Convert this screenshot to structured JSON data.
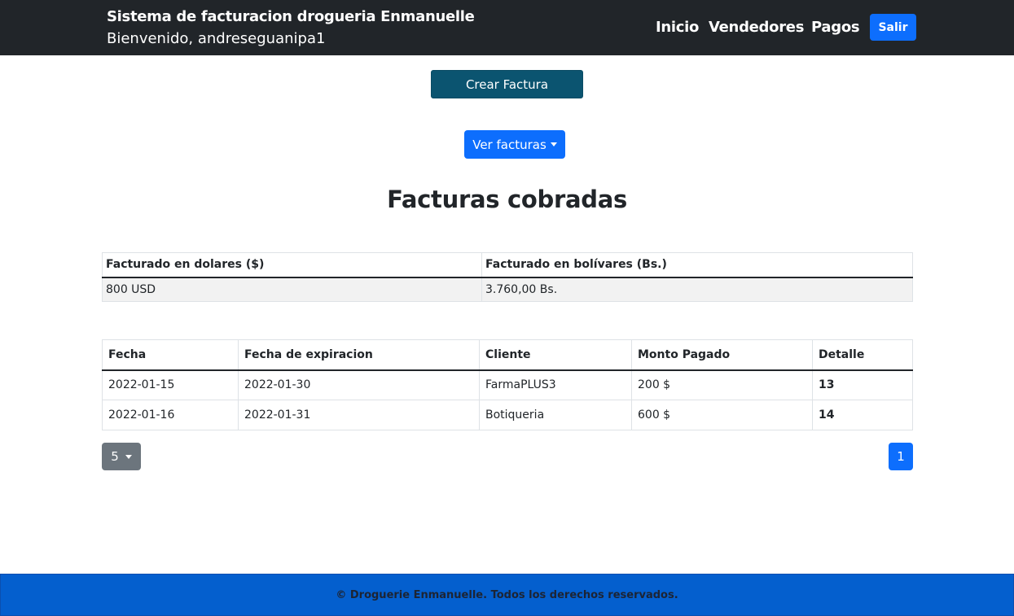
{
  "navbar": {
    "brand_title": "Sistema de facturacion drogueria Enmanuelle",
    "welcome": "Bienvenido, andreseguanipa1",
    "links": [
      "Inicio",
      "Vendedores",
      "Pagos"
    ],
    "logout_label": "Salir"
  },
  "actions": {
    "create_invoice_label": "Crear Factura",
    "view_invoices_label": "Ver facturas"
  },
  "page_title": "Facturas cobradas",
  "summary": {
    "headers": [
      "Facturado en dolares ($)",
      "Facturado en bolívares (Bs.)"
    ],
    "values": [
      "800 USD",
      "3.760,00 Bs."
    ]
  },
  "invoices": {
    "headers": [
      "Fecha",
      "Fecha de expiracion",
      "Cliente",
      "Monto Pagado",
      "Detalle"
    ],
    "rows": [
      [
        "2022-01-15",
        "2022-01-30",
        "FarmaPLUS3",
        "200 $",
        "13"
      ],
      [
        "2022-01-16",
        "2022-01-31",
        "Botiqueria",
        "600 $",
        "14"
      ]
    ]
  },
  "pagination": {
    "per_page": "5",
    "current_page": "1"
  },
  "footer": {
    "text": "© Droguerie Enmanuelle. Todos los derechos reservados."
  },
  "colors": {
    "navbar_bg": "#212529",
    "primary": "#0d6efd",
    "create_button": "#0b5470",
    "secondary": "#6c757d",
    "footer_bg": "#045fce"
  }
}
